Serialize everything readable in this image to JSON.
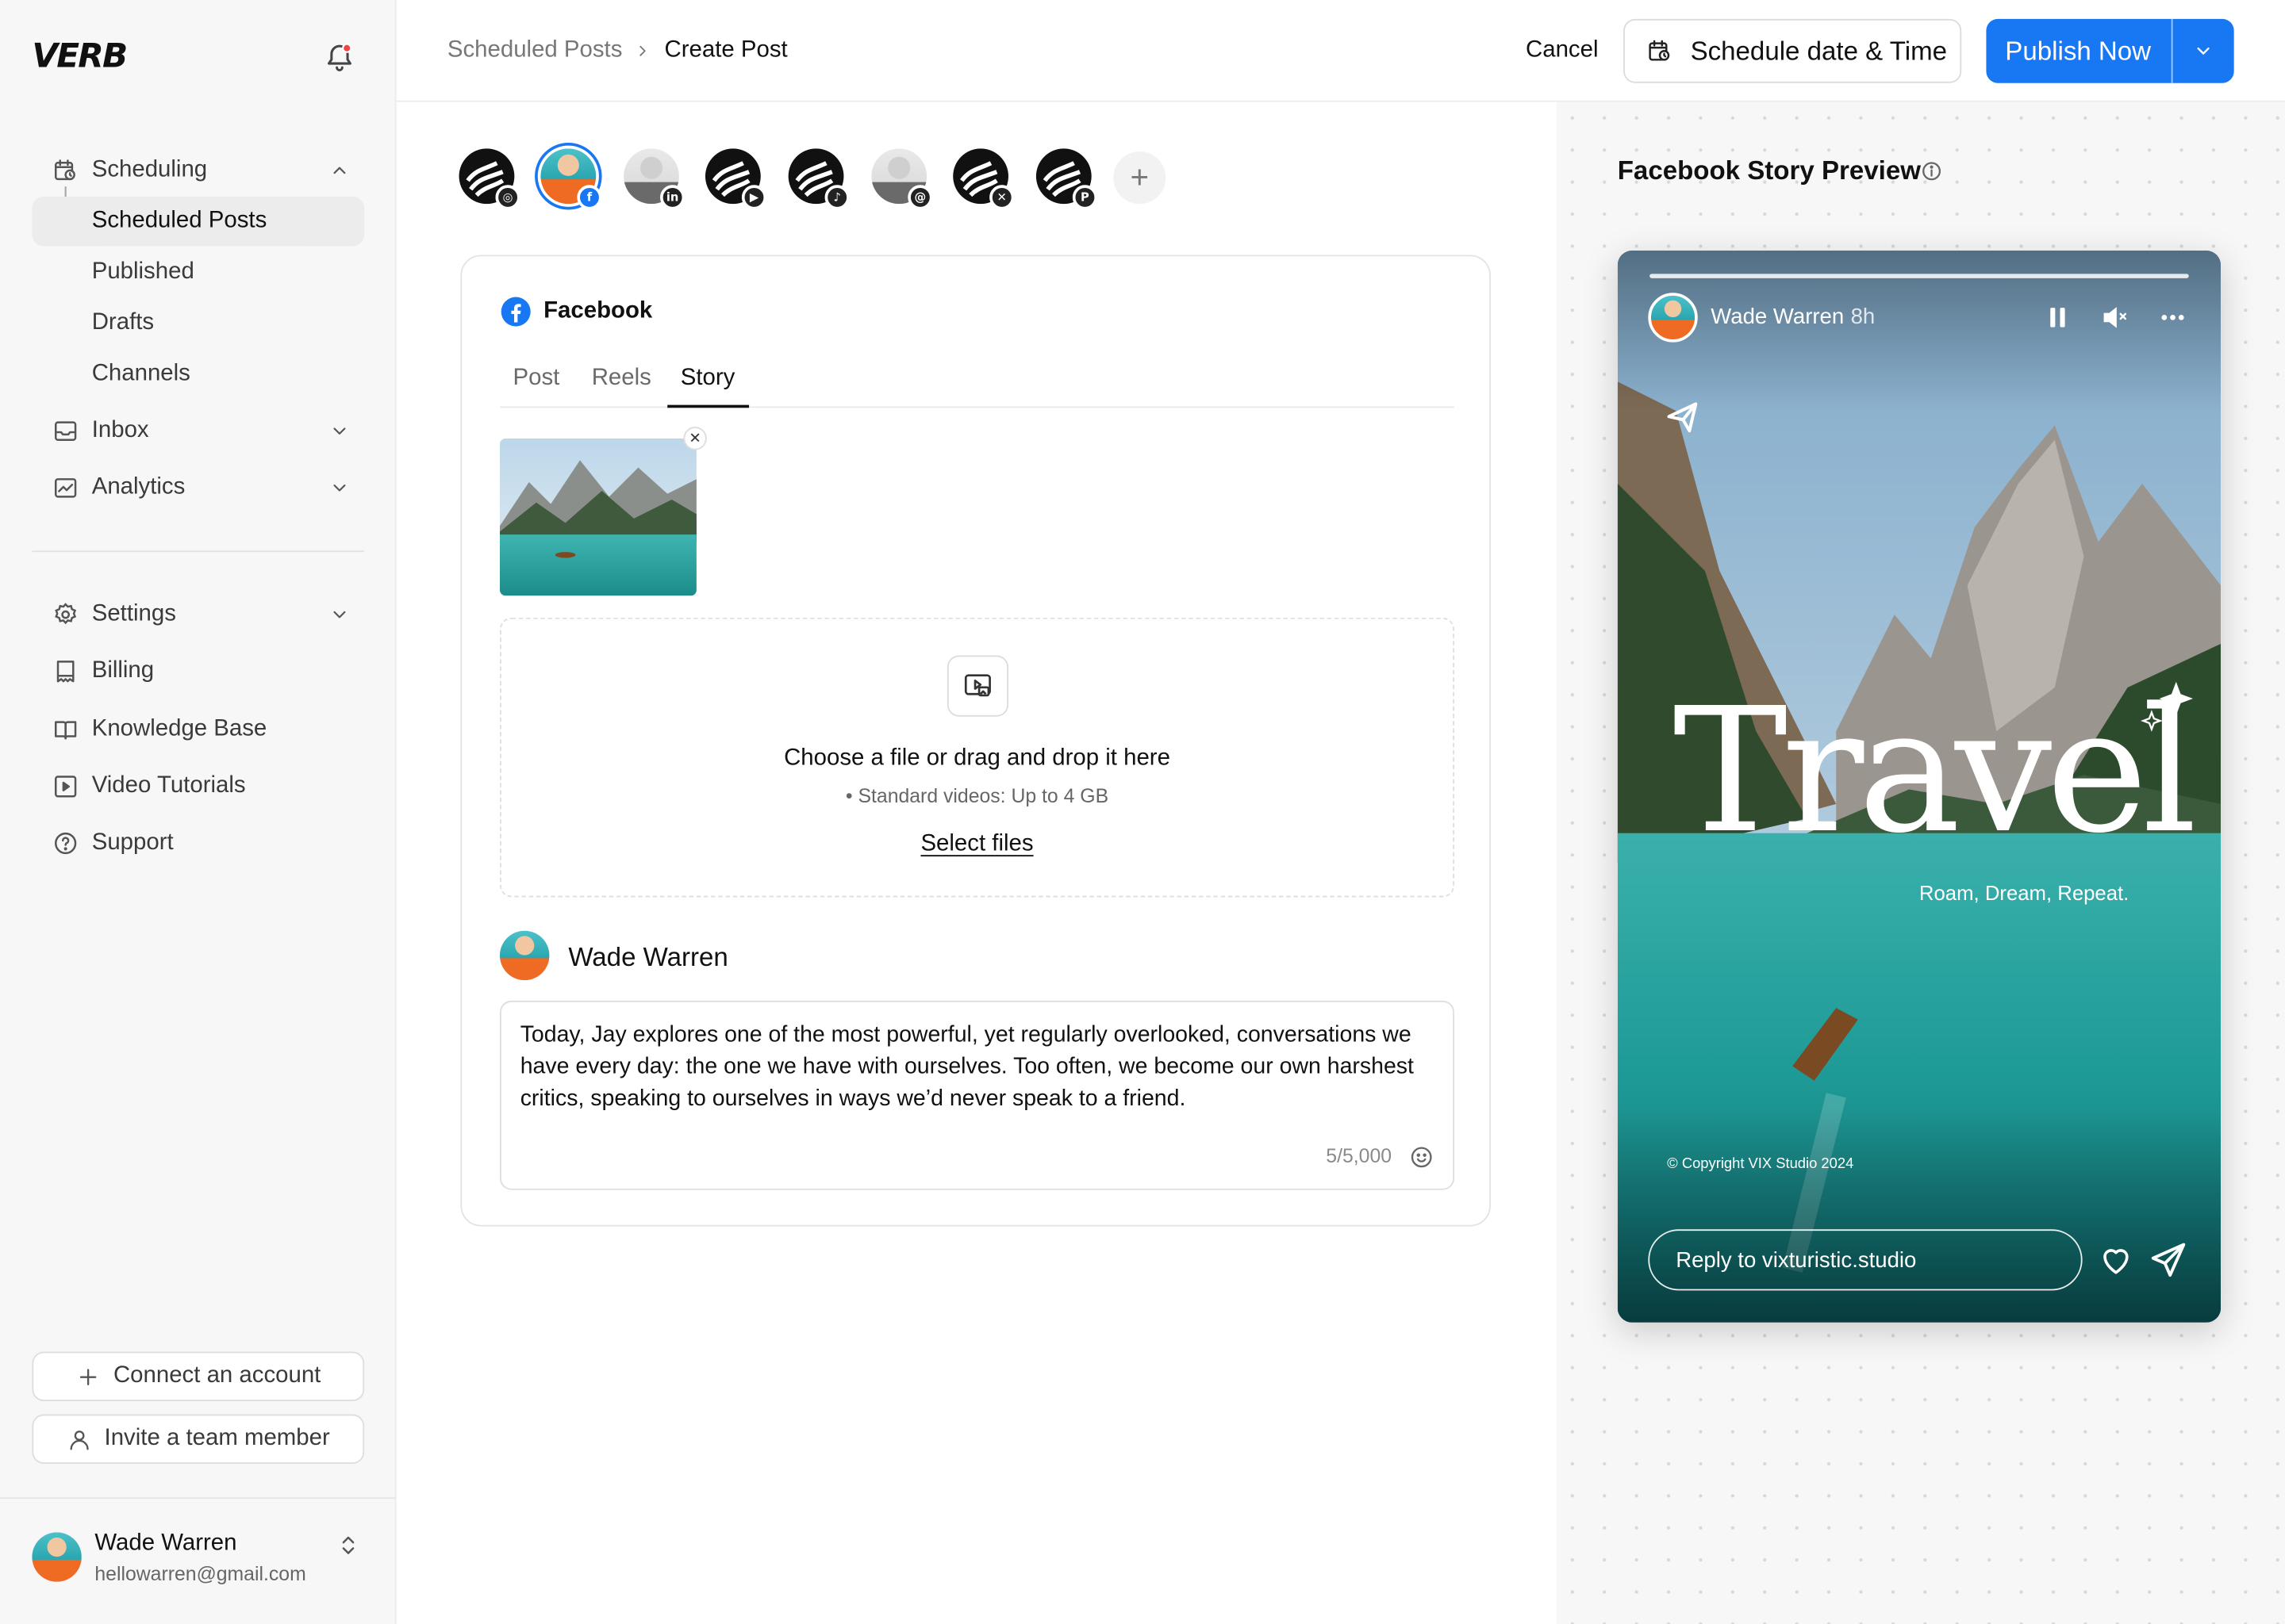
{
  "app": {
    "logo": "VERB"
  },
  "sidebar": {
    "groups": [
      {
        "label": "Scheduling",
        "icon": "calendar-clock-icon",
        "expanded": true,
        "children": [
          "Scheduled Posts",
          "Published",
          "Drafts",
          "Channels"
        ]
      },
      {
        "label": "Inbox",
        "icon": "inbox-icon",
        "expanded": false
      },
      {
        "label": "Analytics",
        "icon": "analytics-icon",
        "expanded": false
      }
    ],
    "secondary": [
      {
        "label": "Settings",
        "icon": "gear-icon"
      },
      {
        "label": "Billing",
        "icon": "receipt-icon"
      },
      {
        "label": "Knowledge Base",
        "icon": "book-icon"
      },
      {
        "label": "Video Tutorials",
        "icon": "play-square-icon"
      },
      {
        "label": "Support",
        "icon": "help-circle-icon"
      }
    ],
    "active_item": "Scheduled Posts",
    "connect_label": "Connect an account",
    "invite_label": "Invite a team member",
    "profile": {
      "name": "Wade Warren",
      "email": "hellowarren@gmail.com"
    }
  },
  "header": {
    "breadcrumb": [
      "Scheduled Posts",
      "Create Post"
    ],
    "cancel_label": "Cancel",
    "schedule_label": "Schedule date & Time",
    "publish_label": "Publish Now",
    "accent_color": "#1877F2"
  },
  "channels": [
    {
      "kind": "brand",
      "network": "instagram"
    },
    {
      "kind": "person",
      "network": "facebook",
      "selected": true
    },
    {
      "kind": "person",
      "network": "linkedin"
    },
    {
      "kind": "brand",
      "network": "youtube"
    },
    {
      "kind": "brand",
      "network": "tiktok"
    },
    {
      "kind": "person",
      "network": "threads"
    },
    {
      "kind": "brand",
      "network": "x"
    },
    {
      "kind": "brand",
      "network": "pinterest"
    }
  ],
  "editor": {
    "network": "Facebook",
    "tabs": [
      "Post",
      "Reels",
      "Story"
    ],
    "active_tab": "Story",
    "dropzone": {
      "title": "Choose a file or drag and drop it here",
      "hint": "Standard videos: Up to 4 GB",
      "link": "Select files"
    },
    "author": "Wade Warren",
    "text": "Today, Jay explores one of the most powerful, yet regularly overlooked, conversations we have every day: the one we have with ourselves. Too often, we become our own harshest critics, speaking to ourselves in ways we’d never speak to a friend.",
    "counter_used": "5",
    "counter_max": "/5,000"
  },
  "preview": {
    "title": "Facebook Story Preview",
    "story": {
      "name": "Wade Warren",
      "time": "8h",
      "headline": "Travel",
      "tagline": "Roam, Dream, Repeat.",
      "copyright": "© Copyright VIX Studio 2024",
      "reply_placeholder": "Reply to vixturistic.studio"
    }
  }
}
